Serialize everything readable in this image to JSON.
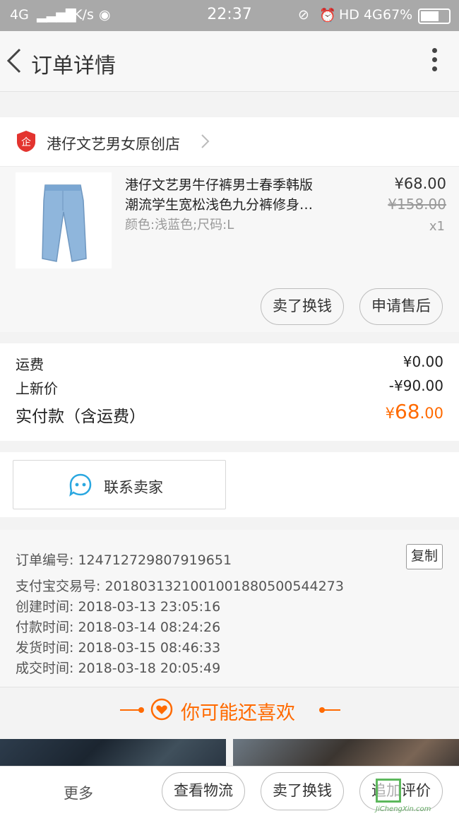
{
  "status_bar": {
    "signal": "4G",
    "speed": "0K/s",
    "time": "22:37",
    "network": "HD 4G",
    "battery": "67%",
    "battery_level": 0.67
  },
  "header": {
    "title": "订单详情"
  },
  "shop": {
    "name": "港仔文艺男女原创店"
  },
  "product": {
    "title_line1": "港仔文艺男牛仔裤男士春季韩版",
    "title_line2": "潮流学生宽松浅色九分裤修身…",
    "spec": "颜色:浅蓝色;尺码:L",
    "price": "¥68.00",
    "original_price": "¥158.00",
    "quantity": "x1",
    "buttons": {
      "sell": "卖了换钱",
      "after_sale": "申请售后"
    }
  },
  "fees": {
    "shipping_label": "运费",
    "shipping_value": "¥0.00",
    "new_price_label": "上新价",
    "new_price_value": "-¥90.00",
    "paid_label": "实付款（含运费）",
    "paid_currency": "¥",
    "paid_int": "68",
    "paid_dec": ".00"
  },
  "contact": {
    "label": "联系卖家"
  },
  "order_info": {
    "order_no": "订单编号: 124712729807919651",
    "alipay_no": "支付宝交易号: 2018031321001001880500544273",
    "created": "创建时间: 2018-03-13 23:05:16",
    "paid": "付款时间: 2018-03-14 08:24:26",
    "shipped": "发货时间: 2018-03-15 08:46:33",
    "completed": "成交时间: 2018-03-18 20:05:49",
    "copy_label": "复制"
  },
  "recommend": {
    "label": "你可能还喜欢"
  },
  "bottom_bar": {
    "more": "更多",
    "logistics": "查看物流",
    "sell": "卖了换钱",
    "review": "追加评价"
  },
  "watermark": {
    "text": "JiChengXin.com"
  },
  "colors": {
    "accent": "#ff6a00",
    "shop_badge": "#e3342f",
    "contact_icon": "#2aa7e0"
  }
}
